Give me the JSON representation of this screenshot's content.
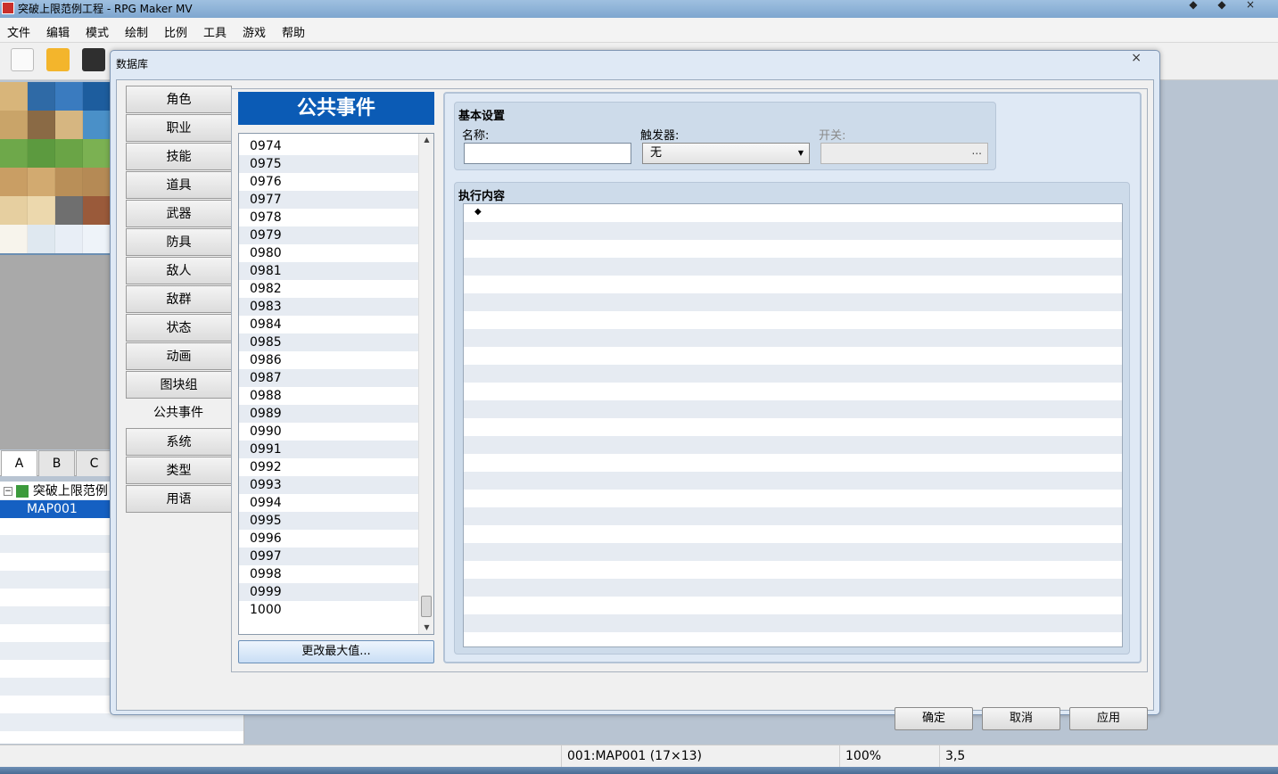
{
  "window": {
    "title": "突破上限范例工程 - RPG Maker MV"
  },
  "menu": [
    "文件",
    "编辑",
    "模式",
    "绘制",
    "比例",
    "工具",
    "游戏",
    "帮助"
  ],
  "tile_tabs": [
    "A",
    "B",
    "C"
  ],
  "map_tree": {
    "project": "突破上限范例",
    "map": "MAP001"
  },
  "status": {
    "map": "001:MAP001 (17×13)",
    "zoom": "100%",
    "coords": "3,5"
  },
  "dialog": {
    "title": "数据库",
    "categories": [
      "角色",
      "职业",
      "技能",
      "道具",
      "武器",
      "防具",
      "敌人",
      "敌群",
      "状态",
      "动画",
      "图块组",
      "公共事件",
      "系统",
      "类型",
      "用语"
    ],
    "active_category": "公共事件",
    "list_header": "公共事件",
    "list_items": [
      "0974",
      "0975",
      "0976",
      "0977",
      "0978",
      "0979",
      "0980",
      "0981",
      "0982",
      "0983",
      "0984",
      "0985",
      "0986",
      "0987",
      "0988",
      "0989",
      "0990",
      "0991",
      "0992",
      "0993",
      "0994",
      "0995",
      "0996",
      "0997",
      "0998",
      "0999",
      "1000"
    ],
    "change_max_label": "更改最大值...",
    "basic": {
      "title": "基本设置",
      "name_label": "名称:",
      "name_value": "",
      "trigger_label": "触发器:",
      "trigger_value": "无",
      "switch_label": "开关:",
      "switch_button": "..."
    },
    "content": {
      "title": "执行内容",
      "first_command": "◆"
    },
    "buttons": {
      "ok": "确定",
      "cancel": "取消",
      "apply": "应用"
    }
  }
}
